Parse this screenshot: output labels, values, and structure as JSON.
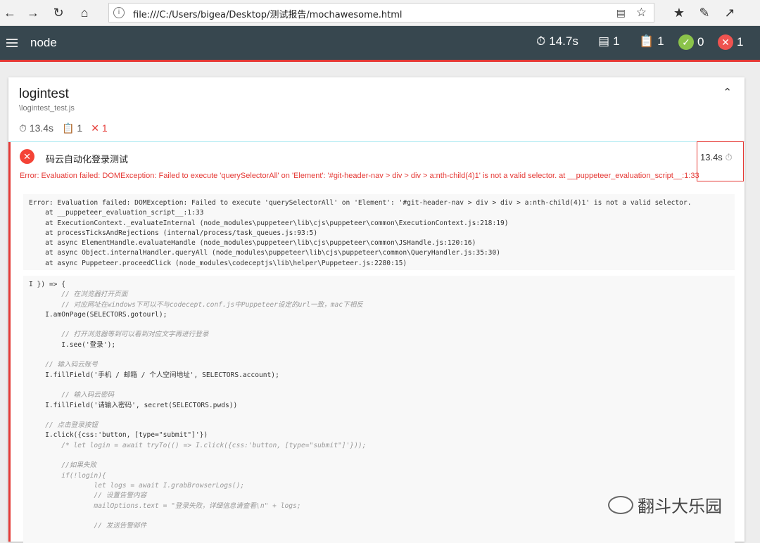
{
  "browser": {
    "url": "file:///C:/Users/bigea/Desktop/测试报告/mochawesome.html"
  },
  "nav": {
    "title": "node",
    "duration": "14.7s",
    "suites": "1",
    "tests": "1",
    "passed": "0",
    "failed": "1"
  },
  "suite": {
    "title": "logintest",
    "file": "\\logintest_test.js",
    "duration": "13.4s",
    "tests": "1",
    "failed": "1"
  },
  "test": {
    "title": "码云自动化登录测试",
    "duration": "13.4s",
    "error": "Error: Evaluation failed: DOMException: Failed to execute 'querySelectorAll' on 'Element': '#git-header-nav > div > div > a:nth-child(4)1' is not a valid selector. at __puppeteer_evaluation_script__:1:33"
  },
  "stack_lines": [
    "Error: Evaluation failed: DOMException: Failed to execute 'querySelectorAll' on 'Element': '#git-header-nav > div > div > a:nth-child(4)1' is not a valid selector.",
    "    at __puppeteer_evaluation_script__:1:33",
    "    at ExecutionContext._evaluateInternal (node_modules\\puppeteer\\lib\\cjs\\puppeteer\\common\\ExecutionContext.js:218:19)",
    "    at processTicksAndRejections (internal/process/task_queues.js:93:5)",
    "    at async ElementHandle.evaluateHandle (node_modules\\puppeteer\\lib\\cjs\\puppeteer\\common\\JSHandle.js:120:16)",
    "    at async Object.internalHandler.queryAll (node_modules\\puppeteer\\lib\\cjs\\puppeteer\\common\\QueryHandler.js:35:30)",
    "    at async Puppeteer.proceedClick (node_modules\\codeceptjs\\lib\\helper\\Puppeteer.js:2280:15)"
  ],
  "code_lines": [
    {
      "t": "I }) => {",
      "k": "code"
    },
    {
      "t": "        // 在浏览器打开页面",
      "k": "comment"
    },
    {
      "t": "        // 对应网址在windows下可以不与codecept.conf.js中Puppeteer设定的url一致，mac下相反",
      "k": "comment"
    },
    {
      "t": "    I.amOnPage(SELECTORS.gotourl);",
      "k": "code"
    },
    {
      "t": "",
      "k": "code"
    },
    {
      "t": "        // 打开浏览器等到可以看到对应文字再进行登录",
      "k": "comment"
    },
    {
      "t": "        I.see('登录');",
      "k": "code"
    },
    {
      "t": "",
      "k": "code"
    },
    {
      "t": "    // 输入码云账号",
      "k": "comment"
    },
    {
      "t": "    I.fillField('手机 / 邮箱 / 个人空间地址', SELECTORS.account);",
      "k": "code"
    },
    {
      "t": "",
      "k": "code"
    },
    {
      "t": "        // 输入码云密码",
      "k": "comment"
    },
    {
      "t": "    I.fillField('请输入密码', secret(SELECTORS.pwds))",
      "k": "code"
    },
    {
      "t": "",
      "k": "code"
    },
    {
      "t": "    // 点击登录按钮",
      "k": "comment"
    },
    {
      "t": "    I.click({css:'button, [type=\"submit\"]'})",
      "k": "code"
    },
    {
      "t": "        /* let login = await tryTo(() => I.click({css:'button, [type=\"submit\"]'}));",
      "k": "comment"
    },
    {
      "t": "",
      "k": "code"
    },
    {
      "t": "        //如果失败",
      "k": "comment"
    },
    {
      "t": "        if(!login){",
      "k": "comment"
    },
    {
      "t": "                let logs = await I.grabBrowserLogs();",
      "k": "comment"
    },
    {
      "t": "                // 设置告警内容",
      "k": "comment"
    },
    {
      "t": "                mailOptions.text = \"登录失败，详细信息请查看\\n\" + logs;",
      "k": "comment"
    },
    {
      "t": "",
      "k": "code"
    },
    {
      "t": "                // 发送告警邮件",
      "k": "comment"
    }
  ],
  "watermark": "翻斗大乐园"
}
